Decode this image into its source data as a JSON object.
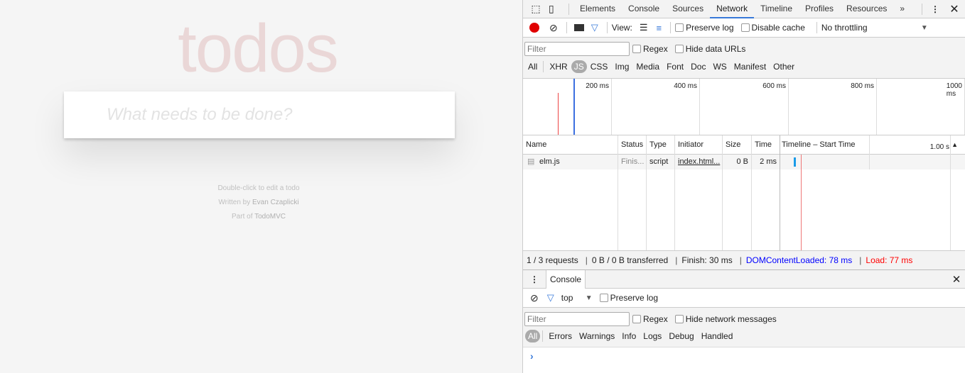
{
  "app": {
    "title": "todos",
    "placeholder": "What needs to be done?",
    "info1": "Double-click to edit a todo",
    "info2_prefix": "Written by ",
    "info2_author": "Evan Czaplicki",
    "info3_prefix": "Part of ",
    "info3_link": "TodoMVC"
  },
  "devtools": {
    "tabs": [
      "Elements",
      "Console",
      "Sources",
      "Network",
      "Timeline",
      "Profiles",
      "Resources"
    ],
    "active_tab": "Network",
    "toolbar": {
      "view_label": "View:",
      "preserve_log": "Preserve log",
      "disable_cache": "Disable cache",
      "throttling": "No throttling"
    },
    "filter": {
      "placeholder": "Filter",
      "regex": "Regex",
      "hide_data_urls": "Hide data URLs"
    },
    "types": [
      "All",
      "XHR",
      "JS",
      "CSS",
      "Img",
      "Media",
      "Font",
      "Doc",
      "WS",
      "Manifest",
      "Other"
    ],
    "active_type": "JS",
    "overview_ticks": [
      "200 ms",
      "400 ms",
      "600 ms",
      "800 ms",
      "1000 ms"
    ],
    "columns": [
      "Name",
      "Status",
      "Type",
      "Initiator",
      "Size",
      "Time",
      "Timeline – Start Time"
    ],
    "timeline_end": "1.00 s",
    "rows": [
      {
        "name": "elm.js",
        "status": "Finis...",
        "type": "script",
        "initiator": "index.html...",
        "size": "0 B",
        "time": "2 ms"
      }
    ],
    "summary": {
      "requests": "1 / 3 requests",
      "transferred": "0 B / 0 B transferred",
      "finish": "Finish: 30 ms",
      "dcl": "DOMContentLoaded: 78 ms",
      "load": "Load: 77 ms"
    },
    "colors": {
      "dcl": "#0000ff",
      "load": "#ff0000",
      "accent": "#3879d9",
      "record": "#e00000"
    },
    "console": {
      "tab": "Console",
      "context": "top",
      "preserve_log": "Preserve log",
      "filter_placeholder": "Filter",
      "regex": "Regex",
      "hide_network": "Hide network messages",
      "levels": [
        "All",
        "Errors",
        "Warnings",
        "Info",
        "Logs",
        "Debug",
        "Handled"
      ],
      "prompt": "›"
    }
  }
}
